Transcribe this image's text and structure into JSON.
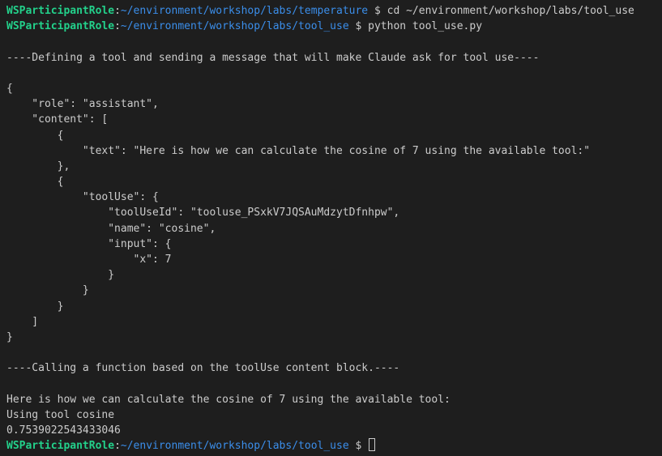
{
  "terminal": {
    "prompt": {
      "user": "WSParticipantRole",
      "separator": ":",
      "symbol": " $ "
    },
    "commands": [
      {
        "path": "~/environment/workshop/labs/temperature",
        "command": "cd ~/environment/workshop/labs/tool_use"
      },
      {
        "path": "~/environment/workshop/labs/tool_use",
        "command": "python tool_use.py"
      }
    ],
    "output": [
      "",
      "----Defining a tool and sending a message that will make Claude ask for tool use----",
      "",
      "{",
      "    \"role\": \"assistant\",",
      "    \"content\": [",
      "        {",
      "            \"text\": \"Here is how we can calculate the cosine of 7 using the available tool:\"",
      "        },",
      "        {",
      "            \"toolUse\": {",
      "                \"toolUseId\": \"tooluse_PSxkV7JQSAuMdzytDfnhpw\",",
      "                \"name\": \"cosine\",",
      "                \"input\": {",
      "                    \"x\": 7",
      "                }",
      "            }",
      "        }",
      "    ]",
      "}",
      "",
      "----Calling a function based on the toolUse content block.----",
      "",
      "Here is how we can calculate the cosine of 7 using the available tool:",
      "Using tool cosine",
      "0.7539022543433046"
    ],
    "final_prompt": {
      "path": "~/environment/workshop/labs/tool_use"
    }
  }
}
